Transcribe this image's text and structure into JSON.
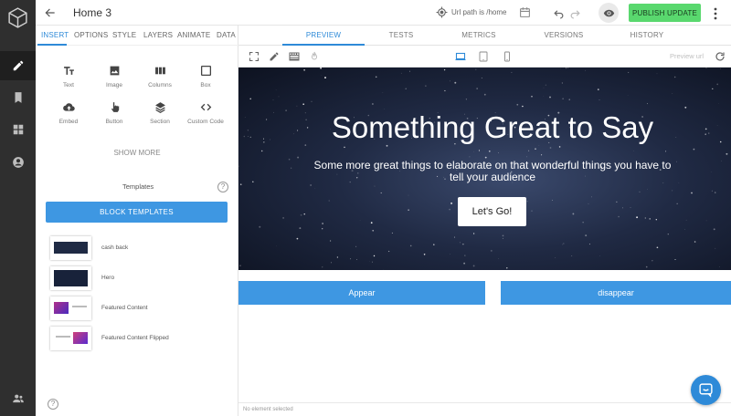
{
  "topbar": {
    "title": "Home 3",
    "url_path": "Url path is /home",
    "publish_label": "PUBLISH UPDATE"
  },
  "panel": {
    "tabs": [
      {
        "label": "INSERT",
        "active": true
      },
      {
        "label": "OPTIONS"
      },
      {
        "label": "STYLE"
      },
      {
        "label": "LAYERS"
      },
      {
        "label": "ANIMATE"
      },
      {
        "label": "DATA"
      }
    ],
    "elements": [
      {
        "label": "Text",
        "icon": "text-icon"
      },
      {
        "label": "Image",
        "icon": "image-icon"
      },
      {
        "label": "Columns",
        "icon": "columns-icon"
      },
      {
        "label": "Box",
        "icon": "box-icon"
      },
      {
        "label": "Embed",
        "icon": "cloud-icon"
      },
      {
        "label": "Button",
        "icon": "pointer-icon"
      },
      {
        "label": "Section",
        "icon": "layers-icon"
      },
      {
        "label": "Custom Code",
        "icon": "code-icon"
      }
    ],
    "show_more": "SHOW MORE",
    "templates_label": "Templates",
    "help_glyph": "?",
    "block_templates": "BLOCK TEMPLATES",
    "templates": [
      {
        "name": "cash back"
      },
      {
        "name": "Hero"
      },
      {
        "name": "Featured Content"
      },
      {
        "name": "Featured Content Flipped"
      }
    ]
  },
  "main": {
    "tabs": [
      {
        "label": "PREVIEW",
        "active": true
      },
      {
        "label": "TESTS"
      },
      {
        "label": "METRICS"
      },
      {
        "label": "VERSIONS"
      },
      {
        "label": "HISTORY"
      }
    ],
    "preview_url": "Preview url",
    "hero": {
      "title": "Something Great to Say",
      "subtitle": "Some more great things to elaborate on that wonderful things you have to tell your audience",
      "button": "Let's Go!"
    },
    "appear_label": "Appear",
    "disappear_label": "disappear",
    "status": "No element selected"
  },
  "colors": {
    "accent": "#2e8ad8",
    "button_blue": "#3e97e2",
    "publish_green": "#59d86e",
    "rail": "#2f2f2f"
  }
}
